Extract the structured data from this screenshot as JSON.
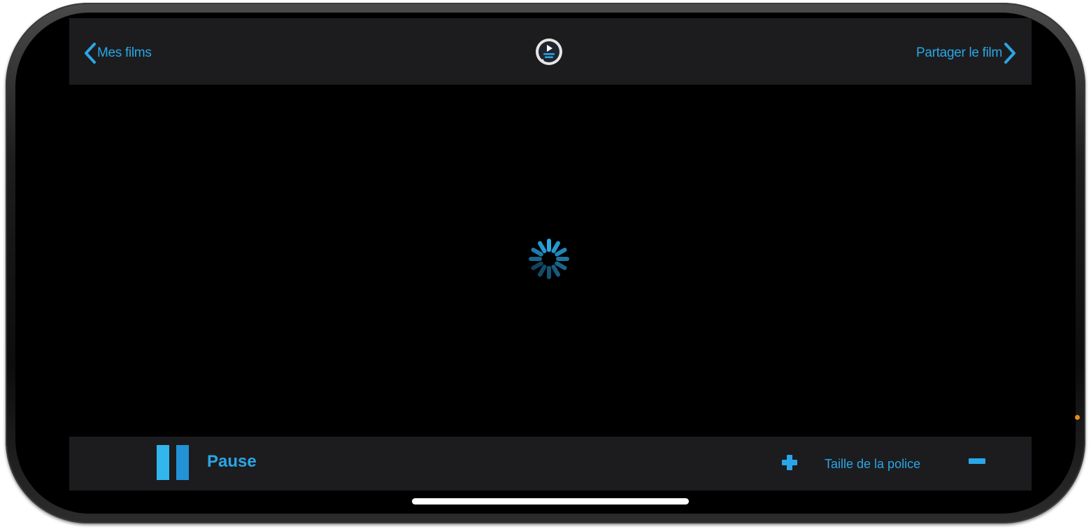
{
  "header": {
    "back_label": "Mes films",
    "share_label": "Partager le film",
    "logo_icon": "play-subtitle-icon"
  },
  "player": {
    "state_icon": "loading-spinner-icon"
  },
  "controls": {
    "pause_label": "Pause",
    "font_size_label": "Taille de la police",
    "increase_icon": "plus-icon",
    "decrease_icon": "minus-icon"
  },
  "colors": {
    "accent": "#2aa6e6",
    "bar_background": "#1c1c1e",
    "screen_background": "#000000",
    "indicator": "#e98a1a"
  }
}
